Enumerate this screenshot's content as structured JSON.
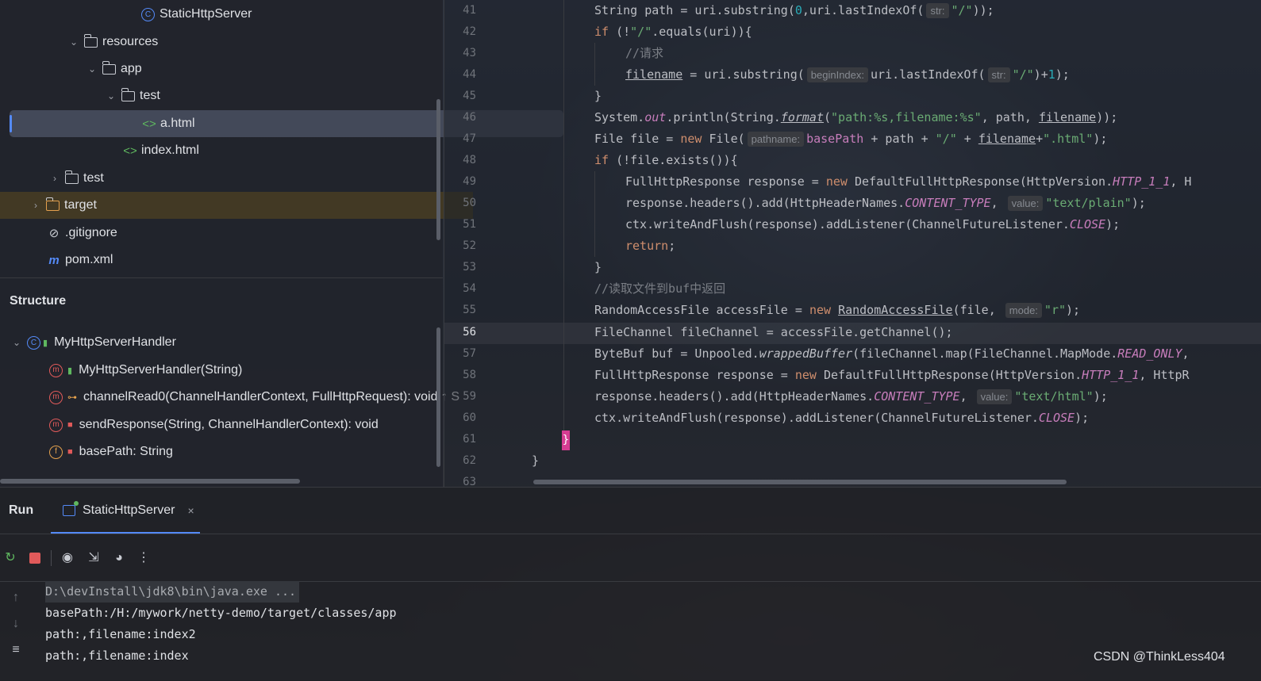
{
  "project_tree": {
    "items": [
      {
        "label": "StaticHttpServer"
      },
      {
        "label": "resources"
      },
      {
        "label": "app"
      },
      {
        "label": "test"
      },
      {
        "label": "a.html"
      },
      {
        "label": "index.html"
      },
      {
        "label": "test"
      },
      {
        "label": "target"
      },
      {
        "label": ".gitignore"
      },
      {
        "label": "pom.xml"
      }
    ]
  },
  "structure": {
    "title": "Structure",
    "items": [
      {
        "label": "MyHttpServerHandler"
      },
      {
        "label": "MyHttpServerHandler(String)"
      },
      {
        "label": "channelRead0(ChannelHandlerContext, FullHttpRequest): void ↑ S"
      },
      {
        "label": "sendResponse(String, ChannelHandlerContext): void"
      },
      {
        "label": "basePath: String"
      }
    ]
  },
  "editor": {
    "current_line": "56",
    "line_numbers": [
      "41",
      "42",
      "43",
      "44",
      "45",
      "46",
      "47",
      "48",
      "49",
      "50",
      "51",
      "52",
      "53",
      "54",
      "55",
      "56",
      "57",
      "58",
      "59",
      "60",
      "61",
      "62",
      "63"
    ],
    "hints": {
      "str": "str:",
      "beginIndex": "beginIndex:",
      "pathname": "pathname:",
      "value": "value:",
      "mode": "mode:"
    },
    "closing_brace": "}",
    "class_brace": "}"
  },
  "run_panel": {
    "title": "Run",
    "tab_label": "StaticHttpServer",
    "tab_close": "×",
    "console_lines": [
      "D:\\devInstall\\jdk8\\bin\\java.exe ...",
      "basePath:/H:/mywork/netty-demo/target/classes/app",
      "path:,filename:index2",
      "path:,filename:index"
    ]
  },
  "watermark": "CSDN @ThinkLess404",
  "colors": {
    "accent": "#548af7",
    "keyword": "#cf8e6d",
    "string": "#6aab73",
    "number": "#2aacb8",
    "static_field": "#c77dbb",
    "comment": "#7a7e85"
  }
}
